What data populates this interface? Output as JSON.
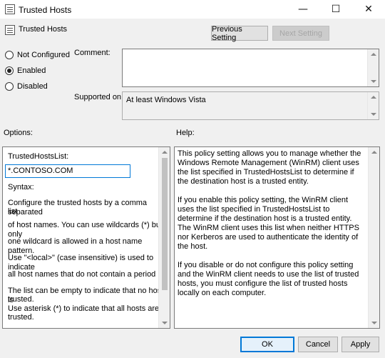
{
  "window": {
    "title": "Trusted Hosts",
    "minimize_glyph": "—",
    "maximize_glyph": "☐",
    "close_glyph": "✕"
  },
  "header": {
    "policy_name": "Trusted Hosts",
    "prev_button": "Previous Setting",
    "next_button": "Next Setting"
  },
  "state_options": [
    {
      "label": "Not Configured",
      "checked": false
    },
    {
      "label": "Enabled",
      "checked": true
    },
    {
      "label": "Disabled",
      "checked": false
    }
  ],
  "comment": {
    "label": "Comment:",
    "value": ""
  },
  "supported": {
    "label": "Supported on:",
    "value": "At least Windows Vista"
  },
  "options": {
    "heading": "Options:",
    "field_label": "TrustedHostsList:",
    "field_value": "*.CONTOSO.COM",
    "lines": [
      "Syntax:",
      "Configure the trusted hosts by a comma separated",
      "list",
      "of host names. You can use wildcards (*) but only",
      "one wildcard is allowed in a host name pattern.",
      "Use \"<local>\" (case insensitive) is used to indicate",
      "all host names that do not contain a period (.).",
      "The list can be empty to indicate that no host is",
      "trusted.",
      "Use asterisk (*)  to indicate that all hosts are",
      "trusted."
    ]
  },
  "help": {
    "heading": "Help:",
    "paragraphs": [
      "This policy setting allows you to manage whether the Windows Remote Management (WinRM) client uses the list specified in TrustedHostsList to determine if the destination host is a trusted entity.",
      "If you enable this policy setting, the WinRM client uses the list specified in TrustedHostsList to determine if the destination host is a trusted entity. The WinRM client uses this list when neither HTTPS nor Kerberos are used to authenticate the identity of the host.",
      "If you disable or do not configure this policy setting and the WinRM client needs to use the list of trusted hosts, you must configure the list of trusted hosts locally on each computer."
    ]
  },
  "footer": {
    "ok": "OK",
    "cancel": "Cancel",
    "apply": "Apply"
  }
}
